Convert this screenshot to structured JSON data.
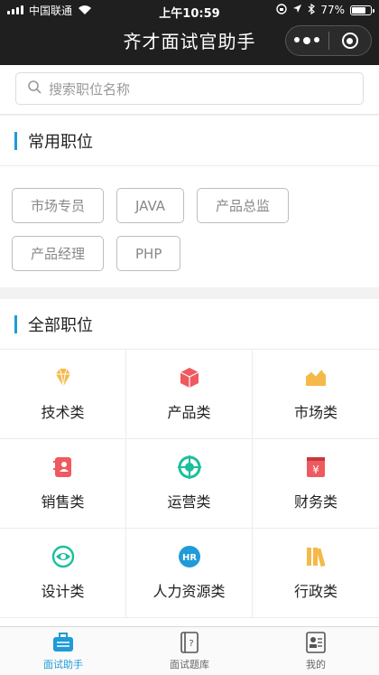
{
  "status_bar": {
    "carrier": "中国联通",
    "time": "上午10:59",
    "battery": "77%",
    "battery_level": 0.77
  },
  "nav": {
    "title": "齐才面试官助手",
    "more_icon": "more-dots-icon",
    "close_icon": "target-icon"
  },
  "search": {
    "placeholder": "搜索职位名称",
    "icon": "search-icon"
  },
  "common_positions": {
    "title": "常用职位",
    "tags": [
      "市场专员",
      "JAVA",
      "产品总监",
      "产品经理",
      "PHP"
    ]
  },
  "all_positions": {
    "title": "全部职位",
    "categories": [
      {
        "label": "技术类",
        "icon": "diamond-icon",
        "color": "#f5b94a"
      },
      {
        "label": "产品类",
        "icon": "cube-icon",
        "color": "#ee5a5f"
      },
      {
        "label": "市场类",
        "icon": "trend-chart-icon",
        "color": "#f5b94a"
      },
      {
        "label": "销售类",
        "icon": "contact-book-icon",
        "color": "#ee5a5f"
      },
      {
        "label": "运营类",
        "icon": "target-icon",
        "color": "#1bbf9c"
      },
      {
        "label": "财务类",
        "icon": "yuan-ledger-icon",
        "color": "#ee5a5f"
      },
      {
        "label": "设计类",
        "icon": "eye-icon",
        "color": "#1bbf9c"
      },
      {
        "label": "人力资源类",
        "icon": "hr-badge-icon",
        "color": "#1e9bd8"
      },
      {
        "label": "行政类",
        "icon": "books-icon",
        "color": "#f5b94a"
      }
    ],
    "hr_badge_text": "HR",
    "yuan_symbol": "¥"
  },
  "tabbar": {
    "items": [
      {
        "label": "面试助手",
        "icon": "briefcase-icon",
        "active": true
      },
      {
        "label": "面试题库",
        "icon": "question-book-icon",
        "active": false
      },
      {
        "label": "我的",
        "icon": "id-card-icon",
        "active": false
      }
    ]
  },
  "colors": {
    "accent": "#1e9bd8",
    "topbar": "#1f1f1f"
  }
}
